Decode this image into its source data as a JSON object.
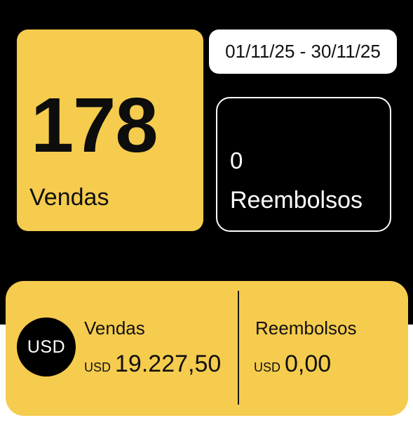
{
  "sales_card": {
    "count": "178",
    "label": "Vendas"
  },
  "date_range": "01/11/25 - 30/11/25",
  "refunds_card": {
    "count": "0",
    "label": "Reembolsos"
  },
  "summary": {
    "currency_badge": "USD",
    "sales": {
      "label": "Vendas",
      "currency": "USD",
      "amount": "19.227,50"
    },
    "refunds": {
      "label": "Reembolsos",
      "currency": "USD",
      "amount": "0,00"
    }
  },
  "colors": {
    "accent": "#f6cc4e",
    "background": "#000000"
  }
}
